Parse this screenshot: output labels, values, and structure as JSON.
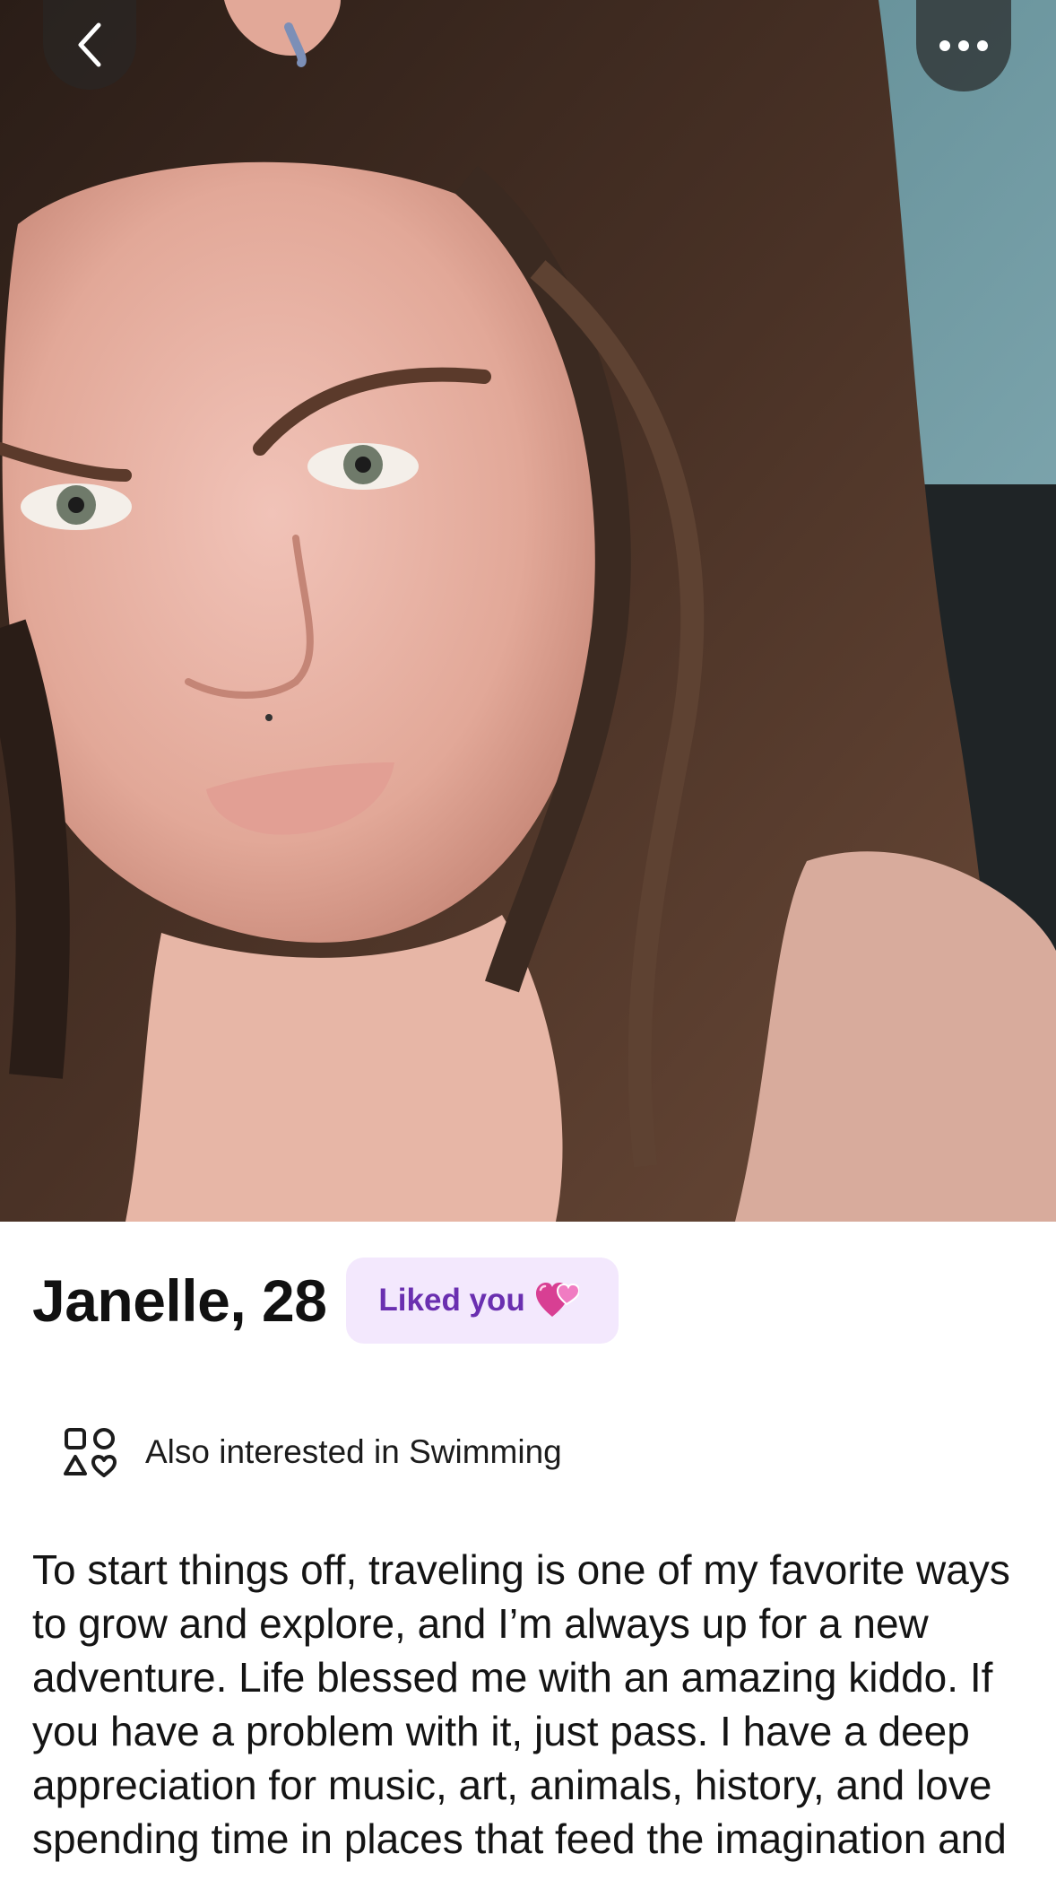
{
  "profile": {
    "name_age": "Janelle, 28",
    "liked_badge": "Liked you",
    "interest": "Also interested in Swimming",
    "bio": "To start things off, traveling is one of my favorite ways to grow and explore, and I’m always up for a new adventure. Life blessed me with an amazing kiddo. If you have a problem with it, just pass. I have a deep appreciation for music, art, animals, history, and love spending time in places that feed the imagination and"
  },
  "icons": {
    "back": "chevron-left-icon",
    "more": "more-horizontal-icon",
    "liked": "two-hearts-icon",
    "interest": "shapes-icon"
  },
  "colors": {
    "badge_bg": "#f3e8fd",
    "badge_text": "#6a2fb0",
    "heart": "#e94fa8"
  }
}
